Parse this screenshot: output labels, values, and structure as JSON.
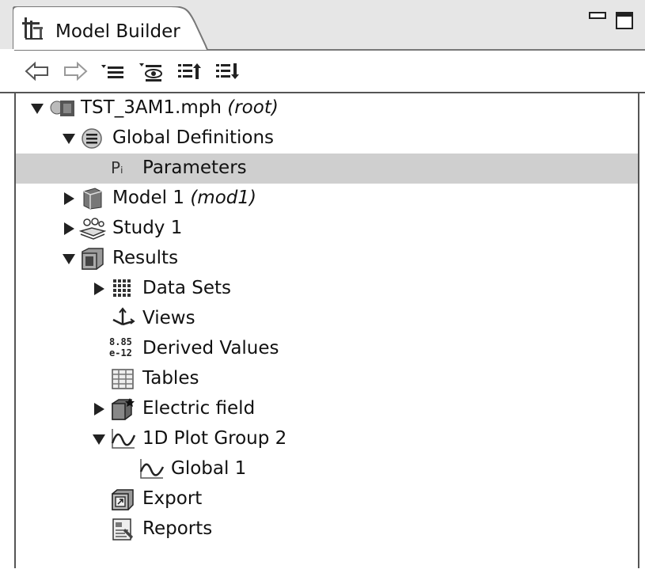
{
  "window": {
    "title": "Model Builder"
  },
  "toolbar": {
    "buttons": [
      {
        "name": "back"
      },
      {
        "name": "forward"
      },
      {
        "name": "show-menu"
      },
      {
        "name": "view-menu"
      },
      {
        "name": "collapse-all"
      },
      {
        "name": "expand-all"
      }
    ]
  },
  "tree": {
    "items": [
      {
        "text": "TST_3AM1.mph ",
        "suffix": "(root)",
        "level": 0,
        "expander": "open",
        "icon": "mph-file-icon"
      },
      {
        "text": "Global Definitions",
        "suffix": "",
        "level": 1,
        "expander": "open",
        "icon": "global-definitions-icon"
      },
      {
        "text": "Parameters",
        "suffix": "",
        "level": 2,
        "expander": "none",
        "icon": "parameters-icon",
        "icon_text": "Pᵢ",
        "selected": true
      },
      {
        "text": "Model 1 ",
        "suffix": "(mod1)",
        "level": 1,
        "expander": "closed",
        "icon": "model-icon"
      },
      {
        "text": "Study 1",
        "suffix": "",
        "level": 1,
        "expander": "closed",
        "icon": "study-icon"
      },
      {
        "text": "Results",
        "suffix": "",
        "level": 1,
        "expander": "open",
        "icon": "results-icon"
      },
      {
        "text": "Data Sets",
        "suffix": "",
        "level": 2,
        "expander": "closed",
        "icon": "data-sets-icon"
      },
      {
        "text": "Views",
        "suffix": "",
        "level": 2,
        "expander": "none",
        "icon": "views-icon"
      },
      {
        "text": "Derived Values",
        "suffix": "",
        "level": 2,
        "expander": "none",
        "icon": "derived-values-icon",
        "icon_text": "8.85 e-12"
      },
      {
        "text": "Tables",
        "suffix": "",
        "level": 2,
        "expander": "none",
        "icon": "tables-icon"
      },
      {
        "text": "Electric field",
        "suffix": "",
        "level": 2,
        "expander": "closed",
        "icon": "electric-field-icon"
      },
      {
        "text": "1D Plot Group 2",
        "suffix": "",
        "level": 2,
        "expander": "open",
        "icon": "plot-group-icon"
      },
      {
        "text": "Global 1",
        "suffix": "",
        "level": 3,
        "expander": "none",
        "icon": "global-plot-icon"
      },
      {
        "text": "Export",
        "suffix": "",
        "level": 2,
        "expander": "none",
        "icon": "export-icon"
      },
      {
        "text": "Reports",
        "suffix": "",
        "level": 2,
        "expander": "none",
        "icon": "reports-icon"
      }
    ]
  },
  "colors": {
    "selection": "#cfcfcf",
    "tab_bar": "#e6e6e6",
    "border": "#555555"
  }
}
